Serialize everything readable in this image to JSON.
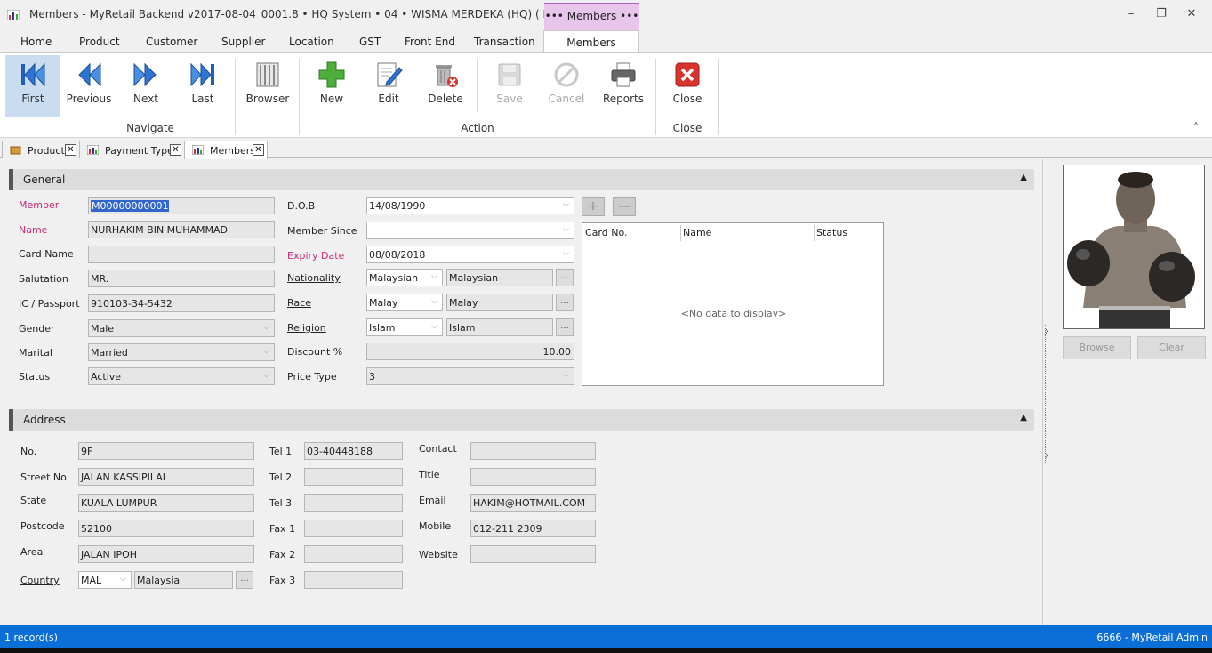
{
  "window": {
    "title": "Members - MyRetail Backend v2017-08-04_0001.8  •  HQ System  •  04 • WISMA MERDEKA (HQ) ( DB : tong )",
    "context_tab": "••• Members •••",
    "minimize": "–",
    "restore": "❐",
    "close": "✕"
  },
  "menu": [
    "Home",
    "Product",
    "Customer",
    "Supplier",
    "Location",
    "GST",
    "Front End",
    "Transaction",
    "Members"
  ],
  "ribbon": {
    "buttons": {
      "first": "First",
      "previous": "Previous",
      "next": "Next",
      "last": "Last",
      "browser": "Browser",
      "new": "New",
      "edit": "Edit",
      "delete": "Delete",
      "save": "Save",
      "cancel": "Cancel",
      "reports": "Reports",
      "close": "Close"
    },
    "groups": {
      "navigate": "Navigate",
      "action": "Action",
      "close": "Close"
    },
    "collapse": "˄"
  },
  "doc_tabs": [
    "Product",
    "Payment Type",
    "Members"
  ],
  "tab_close": "✕",
  "general": {
    "header": "General",
    "caret": "▲",
    "labels": {
      "member": "Member",
      "name": "Name",
      "card_name": "Card Name",
      "salutation": "Salutation",
      "ic_passport": "IC / Passport",
      "gender": "Gender",
      "marital": "Marital",
      "status": "Status",
      "dob": "D.O.B",
      "member_since": "Member Since",
      "expiry_date": "Expiry Date",
      "nationality": "Nationality",
      "race": "Race",
      "religion": "Religion",
      "discount": "Discount %",
      "price_type": "Price Type"
    },
    "values": {
      "member": "M00000000001",
      "name": "NURHAKIM BIN MUHAMMAD",
      "card_name": "",
      "salutation": "MR.",
      "ic_passport": "910103-34-5432",
      "gender": "Male",
      "marital": "Married",
      "status": "Active",
      "dob": "14/08/1990",
      "member_since": "",
      "expiry_date": "08/08/2018",
      "nationality_code": "Malaysian",
      "nationality_desc": "Malaysian",
      "race_code": "Malay",
      "race_desc": "Malay",
      "religion_code": "Islam",
      "religion_desc": "Islam",
      "discount": "10.00",
      "price_type": "3"
    }
  },
  "ellipsis": "...",
  "dropdown_arrow": "⌵",
  "cards": {
    "add": "+",
    "remove": "—",
    "columns": [
      "Card No.",
      "Name",
      "Status"
    ],
    "empty_text": "<No data to display>"
  },
  "address": {
    "header": "Address",
    "caret": "▲",
    "labels": {
      "no": "No.",
      "street_no": "Street No.",
      "state": "State",
      "postcode": "Postcode",
      "area": "Area",
      "country": "Country",
      "tel1": "Tel 1",
      "tel2": "Tel 2",
      "tel3": "Tel 3",
      "fax1": "Fax 1",
      "fax2": "Fax 2",
      "fax3": "Fax 3",
      "contact": "Contact",
      "title": "Title",
      "email": "Email",
      "mobile": "Mobile",
      "website": "Website"
    },
    "values": {
      "no": "9F",
      "street_no": "JALAN KASSIPILAI",
      "state": "KUALA LUMPUR",
      "postcode": "52100",
      "area": "JALAN IPOH",
      "country_code": "MAL",
      "country_name": "Malaysia",
      "tel1": "03-40448188",
      "tel2": "",
      "tel3": "",
      "fax1": "",
      "fax2": "",
      "fax3": "",
      "contact": "",
      "title": "",
      "email": "HAKIM@HOTMAIL.COM",
      "mobile": "012-211 2309",
      "website": ""
    }
  },
  "photo_panel": {
    "browse": "Browse",
    "clear": "Clear",
    "arrow": "›"
  },
  "statusbar": {
    "left": "1 record(s)",
    "right": "6666 - MyRetail Admin"
  },
  "colors": {
    "accent": "#0c6fd8",
    "context_tab": "#e8c6ec",
    "required_label": "#c8287a",
    "selected_button": "#c9dcf0"
  }
}
